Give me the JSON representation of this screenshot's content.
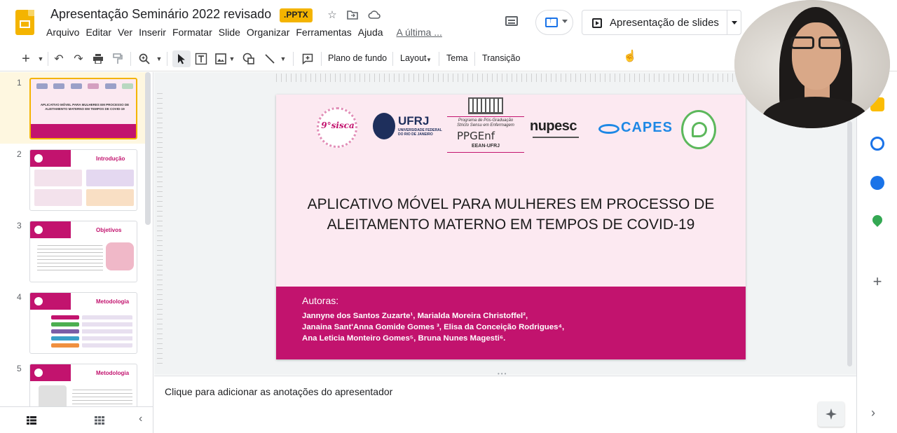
{
  "header": {
    "doc_title": "Apresentação Seminário 2022 revisado",
    "file_badge": ".PPTX",
    "present_label": "Apresentação de slides"
  },
  "menu": {
    "items": [
      "Arquivo",
      "Editar",
      "Ver",
      "Inserir",
      "Formatar",
      "Slide",
      "Organizar",
      "Ferramentas",
      "Ajuda"
    ],
    "last_edit": "A última ..."
  },
  "toolbar": {
    "background": "Plano de fundo",
    "layout": "Layout",
    "theme": "Tema",
    "transition": "Transição"
  },
  "filmstrip": {
    "slides": [
      {
        "num": "1",
        "heading": ""
      },
      {
        "num": "2",
        "heading": "Introdução"
      },
      {
        "num": "3",
        "heading": "Objetivos"
      },
      {
        "num": "4",
        "heading": "Metodologia"
      },
      {
        "num": "5",
        "heading": "Metodologia"
      }
    ]
  },
  "slide": {
    "logos": {
      "sisca": "9°sisca",
      "ufrj": "UFRJ",
      "ufrj_sub": "UNIVERSIDADE FEDERAL DO RIO DE JANEIRO",
      "ppgenf_line1": "Programa de Pós-Graduação",
      "ppgenf_line2": "Stricto Sensu em Enfermagem",
      "ppgenf": "PPGEnf",
      "ppgenf_sub": "EEAN-UFRJ",
      "nupesc": "nupesc",
      "capes": "CAPES"
    },
    "title_line1": "APLICATIVO MÓVEL PARA MULHERES EM PROCESSO DE",
    "title_line2": "ALEITAMENTO MATERNO EM TEMPOS DE COVID-19",
    "authors_label": "Autoras:",
    "author_lines": [
      "Jannyne dos Santos Zuzarte¹, Marialda Moreira Christoffel²,",
      "Janaina Sant'Anna Gomide Gomes ³, Elisa da Conceição Rodrigues⁴,",
      "Ana Leticia Monteiro Gomes⁵, Bruna Nunes Magesti⁶."
    ]
  },
  "notes": {
    "placeholder": "Clique para adicionar as anotações do apresentador"
  },
  "colors": {
    "accent_pink": "#c2136e",
    "slide_bg": "#fce9f1",
    "selection_yellow": "#f4b400"
  }
}
